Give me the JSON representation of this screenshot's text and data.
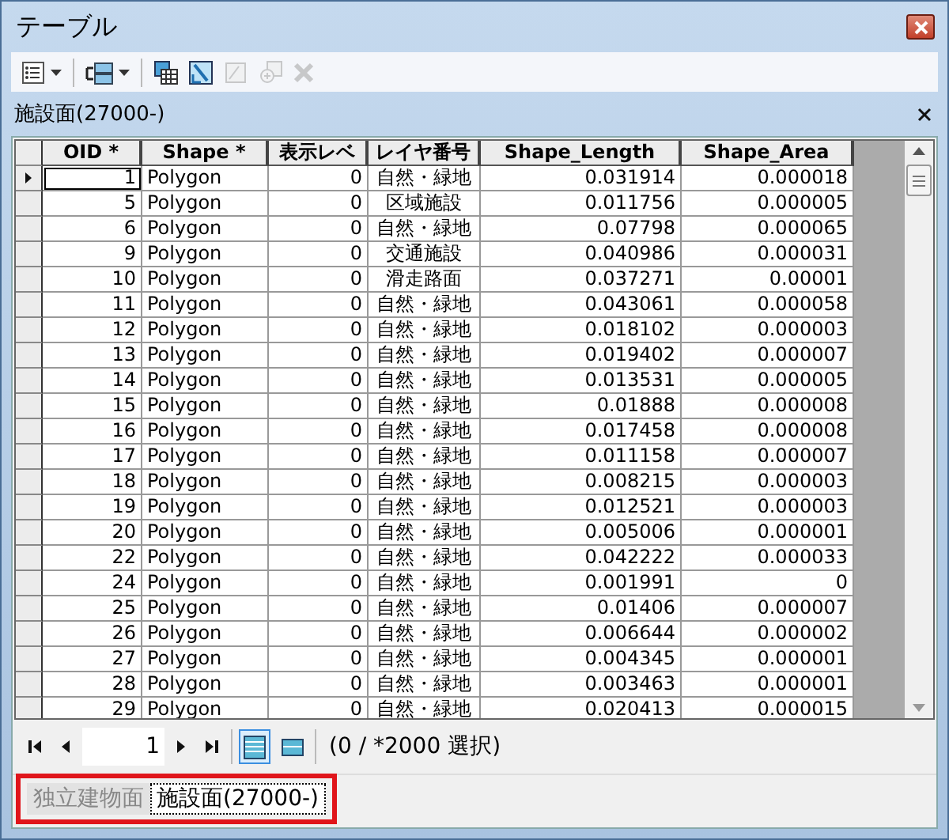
{
  "window": {
    "title": "テーブル"
  },
  "toolbar": [
    {
      "kind": "options",
      "disabled": false,
      "menu": true
    },
    {
      "kind": "related",
      "disabled": false,
      "menu": true
    },
    {
      "kind": "select-by-attributes",
      "disabled": false,
      "menu": false
    },
    {
      "kind": "switch-selection",
      "disabled": false,
      "menu": false
    },
    {
      "kind": "clear-selection",
      "disabled": true,
      "menu": false
    },
    {
      "kind": "zoom-to-selected",
      "disabled": true,
      "menu": false
    },
    {
      "kind": "delete",
      "disabled": true,
      "menu": false
    }
  ],
  "table_title": "施設面(27000-)",
  "table": {
    "columns": [
      "OID *",
      "Shape *",
      "表示レベ",
      "レイヤ番号",
      "Shape_Length",
      "Shape_Area"
    ],
    "rows": [
      {
        "current": true,
        "cells": [
          "1",
          "Polygon",
          "0",
          "自然・緑地",
          "0.031914",
          "0.000018"
        ]
      },
      {
        "current": false,
        "cells": [
          "5",
          "Polygon",
          "0",
          "区域施設",
          "0.011756",
          "0.000005"
        ]
      },
      {
        "current": false,
        "cells": [
          "6",
          "Polygon",
          "0",
          "自然・緑地",
          "0.07798",
          "0.000065"
        ]
      },
      {
        "current": false,
        "cells": [
          "9",
          "Polygon",
          "0",
          "交通施設",
          "0.040986",
          "0.000031"
        ]
      },
      {
        "current": false,
        "cells": [
          "10",
          "Polygon",
          "0",
          "滑走路面",
          "0.037271",
          "0.00001"
        ]
      },
      {
        "current": false,
        "cells": [
          "11",
          "Polygon",
          "0",
          "自然・緑地",
          "0.043061",
          "0.000058"
        ]
      },
      {
        "current": false,
        "cells": [
          "12",
          "Polygon",
          "0",
          "自然・緑地",
          "0.018102",
          "0.000003"
        ]
      },
      {
        "current": false,
        "cells": [
          "13",
          "Polygon",
          "0",
          "自然・緑地",
          "0.019402",
          "0.000007"
        ]
      },
      {
        "current": false,
        "cells": [
          "14",
          "Polygon",
          "0",
          "自然・緑地",
          "0.013531",
          "0.000005"
        ]
      },
      {
        "current": false,
        "cells": [
          "15",
          "Polygon",
          "0",
          "自然・緑地",
          "0.01888",
          "0.000008"
        ]
      },
      {
        "current": false,
        "cells": [
          "16",
          "Polygon",
          "0",
          "自然・緑地",
          "0.017458",
          "0.000008"
        ]
      },
      {
        "current": false,
        "cells": [
          "17",
          "Polygon",
          "0",
          "自然・緑地",
          "0.011158",
          "0.000007"
        ]
      },
      {
        "current": false,
        "cells": [
          "18",
          "Polygon",
          "0",
          "自然・緑地",
          "0.008215",
          "0.000003"
        ]
      },
      {
        "current": false,
        "cells": [
          "19",
          "Polygon",
          "0",
          "自然・緑地",
          "0.012521",
          "0.000003"
        ]
      },
      {
        "current": false,
        "cells": [
          "20",
          "Polygon",
          "0",
          "自然・緑地",
          "0.005006",
          "0.000001"
        ]
      },
      {
        "current": false,
        "cells": [
          "22",
          "Polygon",
          "0",
          "自然・緑地",
          "0.042222",
          "0.000033"
        ]
      },
      {
        "current": false,
        "cells": [
          "24",
          "Polygon",
          "0",
          "自然・緑地",
          "0.001991",
          "0"
        ]
      },
      {
        "current": false,
        "cells": [
          "25",
          "Polygon",
          "0",
          "自然・緑地",
          "0.01406",
          "0.000007"
        ]
      },
      {
        "current": false,
        "cells": [
          "26",
          "Polygon",
          "0",
          "自然・緑地",
          "0.006644",
          "0.000002"
        ]
      },
      {
        "current": false,
        "cells": [
          "27",
          "Polygon",
          "0",
          "自然・緑地",
          "0.004345",
          "0.000001"
        ]
      },
      {
        "current": false,
        "cells": [
          "28",
          "Polygon",
          "0",
          "自然・緑地",
          "0.003463",
          "0.000001"
        ]
      },
      {
        "current": false,
        "cells": [
          "29",
          "Polygon",
          "0",
          "自然・緑地",
          "0.020413",
          "0.000015"
        ]
      }
    ]
  },
  "navigator": {
    "page": "1",
    "views": [
      {
        "kind": "all",
        "selected": true
      },
      {
        "kind": "selected",
        "selected": false
      }
    ],
    "status": "(0 / *2000 選択)"
  },
  "tabs": {
    "highlighted": true,
    "items": [
      {
        "label": "独立建物面",
        "selected": false
      },
      {
        "label": "施設面(27000-)",
        "selected": true
      }
    ]
  }
}
